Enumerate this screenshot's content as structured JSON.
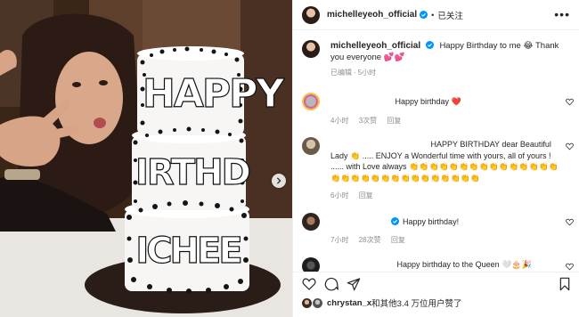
{
  "header": {
    "username": "michelleyeoh_official",
    "separator": "•",
    "follow_label": "已关注",
    "more_label": "•••"
  },
  "caption": {
    "username": "michelleyeoh_official",
    "text": "Happy Birthday to me 😂 Thank you everyone 💕💕",
    "edited": "已编辑",
    "dot": "·",
    "time": "5小时"
  },
  "comments": [
    {
      "text": "Happy birthday ❤️",
      "time": "4小时",
      "likes": "3次赞",
      "reply": "回复"
    },
    {
      "text": "HAPPY BIRTHDAY dear Beautiful Lady 👏 ..... ENJOY a Wonderful time with yours, all of yours ! ...... with Love always 👏👏👏👏👏👏👏👏👏👏👏👏👏👏👏👏👏👏👏👏👏👏👏👏👏👏👏👏👏👏",
      "time": "6小时",
      "reply": "回复"
    },
    {
      "text": "Happy birthday!",
      "time": "7小时",
      "likes": "28次赞",
      "reply": "回复"
    },
    {
      "text": "Happy birthday to the Queen 🤍🎂🎉"
    }
  ],
  "likes": {
    "user": "chrystan_x",
    "rest": "和其他3.4 万位用户赞了"
  },
  "photo": {
    "cake_letters_top": "HAPPY",
    "cake_letters_mid": "IRTHD",
    "cake_letters_bot": "ICHEE"
  },
  "colors": {
    "verified": "#0095f6",
    "heart": "#e0245e",
    "meta": "#8e8e8e"
  },
  "icons": [
    "heart-icon",
    "comment-icon",
    "share-icon",
    "bookmark-icon",
    "more-icon",
    "verified-icon",
    "next-arrow-icon"
  ]
}
